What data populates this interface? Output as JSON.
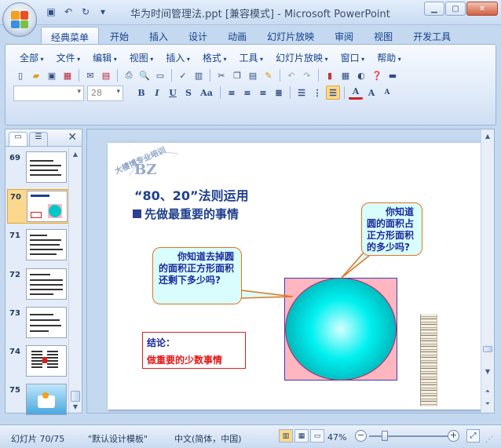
{
  "window": {
    "title": "华为时间管理法.ppt [兼容模式] - Microsoft PowerPoint",
    "buttons": [
      "minimize-icon",
      "maximize-icon",
      "close-icon"
    ]
  },
  "quick_access": [
    "save-icon",
    "undo-icon",
    "redo-icon",
    "customize-icon"
  ],
  "ribbon": {
    "tabs": [
      "经典菜单",
      "开始",
      "插入",
      "设计",
      "动画",
      "幻灯片放映",
      "审阅",
      "视图",
      "开发工具"
    ],
    "active_tab": "经典菜单",
    "menus": [
      "全部",
      "文件",
      "编辑",
      "视图",
      "插入",
      "格式",
      "工具",
      "幻灯片放映",
      "窗口",
      "帮助"
    ],
    "font_name": "",
    "font_size": "28"
  },
  "slides_panel": {
    "tabs": [
      "slides-tab",
      "outline-tab"
    ],
    "items": [
      {
        "num": "69",
        "selected": false
      },
      {
        "num": "70",
        "selected": true
      },
      {
        "num": "71",
        "selected": false
      },
      {
        "num": "72",
        "selected": false
      },
      {
        "num": "73",
        "selected": false
      },
      {
        "num": "74",
        "selected": false
      },
      {
        "num": "75",
        "selected": false
      }
    ]
  },
  "slide": {
    "logo_text": "BZ",
    "logo_arc_text": "大樓博专业培训",
    "title": "“80、20”法则运用",
    "bullet": "先做最重要的事情",
    "callout_left": "你知道去掉圆的面积正方形面积还剩下多少吗?",
    "callout_right": "你知道圆的面积占正方形面积的多少吗?",
    "conclusion_label": "结论：",
    "conclusion_text": "做重要的少数事情",
    "colors": {
      "square": "#ffb6c1",
      "circle": "#00e0e0",
      "title": "#1e3f8c",
      "conclusion": "#e11a1a"
    }
  },
  "statusbar": {
    "slide_info": "幻灯片 70/75",
    "template": "\"默认设计模板\"",
    "language": "中文(简体，中国)",
    "zoom": "47%",
    "zoom_fraction": 0.47
  }
}
